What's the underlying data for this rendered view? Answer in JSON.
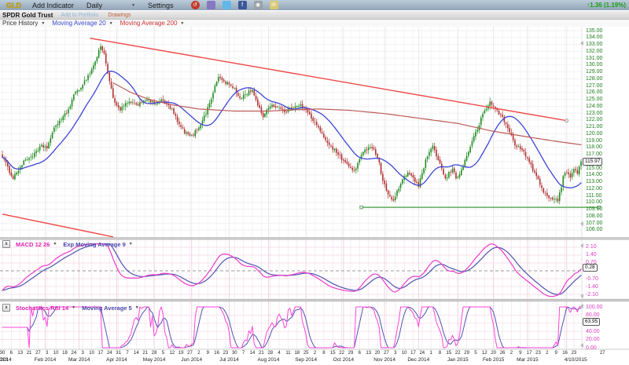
{
  "titlebar": {
    "symbol": "GLD",
    "add_indicator": "Add Indicator",
    "period": "Daily",
    "settings": "Settings",
    "change_arrow": "↑",
    "change": "1.36 (1.19%)",
    "icons": [
      {
        "name": "history-icon",
        "color": "#c23b2e",
        "glyph": "↺",
        "round": true
      },
      {
        "name": "cube-icon",
        "color": "#8578c0",
        "glyph": ""
      },
      {
        "name": "twitter-icon",
        "color": "#62b7e8",
        "glyph": ""
      },
      {
        "name": "facebook-icon",
        "color": "#3b5998",
        "glyph": "f"
      },
      {
        "name": "camera-icon",
        "color": "#9aa0a6",
        "glyph": "◉"
      },
      {
        "name": "mail-icon",
        "color": "#d9c873",
        "glyph": "✉"
      }
    ]
  },
  "subbar": {
    "title": "SPDR Gold Trust",
    "add_to_portfolio": "Add to Portfolio",
    "drawings": "Drawings"
  },
  "legend": {
    "price_history": "Price History",
    "ma20": "Moving Average 20",
    "ma200": "Moving Average 200"
  },
  "price_axis": {
    "badge": "115.97",
    "ticks": [
      "135.00",
      "134.00",
      "133.00",
      "132.00",
      "131.00",
      "130.00",
      "129.00",
      "128.00",
      "127.00",
      "126.00",
      "125.00",
      "124.00",
      "123.00",
      "122.00",
      "121.00",
      "120.00",
      "119.00",
      "118.00",
      "117.00",
      "115.00",
      "114.00",
      "113.00",
      "112.00",
      "111.00",
      "110.00",
      "109.00",
      "108.00",
      "107.00",
      "106.00"
    ]
  },
  "panels": {
    "macd": {
      "close": "x",
      "label": "MACD 12 26",
      "label2": "Exp Moving Average 9",
      "badge": "0.28",
      "ticks": [
        {
          "v": 2.1,
          "label": "2.10"
        },
        {
          "v": 1.4,
          "label": "1.40"
        },
        {
          "v": 0.7,
          "label": "0.70"
        },
        {
          "v": -0.7,
          "label": "-0.70"
        },
        {
          "v": -1.4,
          "label": "-1.40"
        },
        {
          "v": -2.1,
          "label": "-2.10"
        }
      ]
    },
    "stoch": {
      "close": "x",
      "label": "Stochastics RSI 14",
      "label2": "Moving Average 5",
      "badge": "63.95",
      "ticks": [
        {
          "v": 100,
          "label": "100.00"
        },
        {
          "v": 80,
          "label": "80.00"
        },
        {
          "v": 40,
          "label": "40.00"
        },
        {
          "v": 20,
          "label": "20.00"
        },
        {
          "v": 0,
          "label": "0.00"
        }
      ]
    }
  },
  "xaxis": {
    "day_ticks": [
      "30",
      "6",
      "13",
      "21",
      "27",
      "3",
      "10",
      "18",
      "24",
      "3",
      "10",
      "17",
      "24",
      "31",
      "7",
      "14",
      "21",
      "28",
      "5",
      "12",
      "19",
      "27",
      "2",
      "9",
      "16",
      "23",
      "30",
      "7",
      "14",
      "21",
      "28",
      "4",
      "11",
      "18",
      "25",
      "2",
      "8",
      "15",
      "22",
      "29",
      "6",
      "13",
      "20",
      "27",
      "3",
      "10",
      "17",
      "24",
      "1",
      "8",
      "15",
      "22",
      "29",
      "5",
      "12",
      "20",
      "26",
      "2",
      "9",
      "17",
      "23",
      "2",
      "9",
      "16",
      "23"
    ],
    "extra_tick": {
      "day": 336,
      "label": "27"
    },
    "months": [
      {
        "day": 0,
        "label": "2013"
      },
      {
        "day": 2,
        "label": "2014"
      },
      {
        "day": 24,
        "label": "Feb 2014"
      },
      {
        "day": 43,
        "label": "Mar 2014"
      },
      {
        "day": 64,
        "label": "Apr 2014"
      },
      {
        "day": 85,
        "label": "May 2014"
      },
      {
        "day": 106,
        "label": "Jun 2014"
      },
      {
        "day": 127,
        "label": "Jul 2014"
      },
      {
        "day": 149,
        "label": "Aug 2014"
      },
      {
        "day": 170,
        "label": "Sep 2014"
      },
      {
        "day": 191,
        "label": "Oct 2014"
      },
      {
        "day": 214,
        "label": "Nov 2014"
      },
      {
        "day": 233,
        "label": "Dec 2014"
      },
      {
        "day": 255,
        "label": "Jan 2015"
      },
      {
        "day": 275,
        "label": "Feb 2015"
      },
      {
        "day": 294,
        "label": "Mar 2015"
      },
      {
        "day": 321,
        "label": "4/10/2015"
      }
    ]
  },
  "chart_data": {
    "type": "candlestick",
    "symbol": "GLD",
    "title": "SPDR Gold Trust",
    "timeframe": "Daily",
    "date_range": [
      "12/30/2013",
      "4/10/2015"
    ],
    "num_days": 325,
    "price_range": [
      106,
      135
    ],
    "last_price": 115.97,
    "change": 1.36,
    "change_pct": "1.19%",
    "overlays": [
      "Moving Average 20",
      "Moving Average 200"
    ],
    "close_keypoints": [
      [
        0,
        116.8
      ],
      [
        3,
        115.0
      ],
      [
        6,
        113.6
      ],
      [
        9,
        114.8
      ],
      [
        13,
        116.2
      ],
      [
        18,
        117.0
      ],
      [
        22,
        118.2
      ],
      [
        25,
        118.0
      ],
      [
        30,
        121.3
      ],
      [
        36,
        123.0
      ],
      [
        40,
        125.5
      ],
      [
        45,
        127.2
      ],
      [
        49,
        128.8
      ],
      [
        52,
        130.5
      ],
      [
        55,
        132.8
      ],
      [
        57,
        131.5
      ],
      [
        59,
        129.0
      ],
      [
        61,
        126.5
      ],
      [
        63,
        124.3
      ],
      [
        66,
        123.4
      ],
      [
        70,
        124.6
      ],
      [
        75,
        124.2
      ],
      [
        80,
        125.0
      ],
      [
        85,
        124.4
      ],
      [
        90,
        124.8
      ],
      [
        95,
        123.5
      ],
      [
        99,
        121.2
      ],
      [
        103,
        120.0
      ],
      [
        106,
        119.6
      ],
      [
        110,
        121.0
      ],
      [
        114,
        123.0
      ],
      [
        118,
        126.0
      ],
      [
        121,
        128.3
      ],
      [
        124,
        127.6
      ],
      [
        127,
        127.2
      ],
      [
        130,
        126.4
      ],
      [
        133,
        125.2
      ],
      [
        137,
        125.9
      ],
      [
        140,
        126.5
      ],
      [
        143,
        124.0
      ],
      [
        146,
        122.6
      ],
      [
        150,
        124.2
      ],
      [
        154,
        123.9
      ],
      [
        158,
        123.2
      ],
      [
        162,
        123.8
      ],
      [
        166,
        124.3
      ],
      [
        170,
        123.4
      ],
      [
        174,
        122.0
      ],
      [
        178,
        120.3
      ],
      [
        182,
        118.8
      ],
      [
        186,
        117.6
      ],
      [
        190,
        116.4
      ],
      [
        194,
        115.2
      ],
      [
        197,
        114.6
      ],
      [
        200,
        116.2
      ],
      [
        203,
        117.6
      ],
      [
        206,
        118.3
      ],
      [
        209,
        117.2
      ],
      [
        211,
        115.8
      ],
      [
        213,
        113.0
      ],
      [
        216,
        111.4
      ],
      [
        219,
        110.1
      ],
      [
        221,
        111.6
      ],
      [
        224,
        113.2
      ],
      [
        227,
        114.4
      ],
      [
        230,
        113.6
      ],
      [
        233,
        112.3
      ],
      [
        236,
        115.2
      ],
      [
        238,
        116.8
      ],
      [
        241,
        118.0
      ],
      [
        243,
        116.9
      ],
      [
        245,
        115.6
      ],
      [
        248,
        113.3
      ],
      [
        250,
        114.2
      ],
      [
        252,
        114.9
      ],
      [
        254,
        113.6
      ],
      [
        257,
        114.6
      ],
      [
        260,
        116.8
      ],
      [
        263,
        118.9
      ],
      [
        266,
        120.7
      ],
      [
        269,
        122.8
      ],
      [
        273,
        124.6
      ],
      [
        275,
        123.9
      ],
      [
        277,
        123.4
      ],
      [
        280,
        122.3
      ],
      [
        283,
        120.8
      ],
      [
        287,
        118.5
      ],
      [
        290,
        117.8
      ],
      [
        293,
        116.9
      ],
      [
        296,
        115.3
      ],
      [
        299,
        113.8
      ],
      [
        302,
        112.0
      ],
      [
        305,
        111.0
      ],
      [
        308,
        110.5
      ],
      [
        311,
        110.2
      ],
      [
        313,
        112.4
      ],
      [
        314,
        114.1
      ],
      [
        316,
        114.6
      ],
      [
        318,
        113.6
      ],
      [
        320,
        114.9
      ],
      [
        322,
        114.3
      ],
      [
        324,
        115.97
      ]
    ],
    "ma200_keypoints": [
      [
        62,
        127.4
      ],
      [
        72,
        126.0
      ],
      [
        82,
        125.0
      ],
      [
        95,
        124.2
      ],
      [
        110,
        123.6
      ],
      [
        130,
        123.3
      ],
      [
        150,
        123.3
      ],
      [
        165,
        123.5
      ],
      [
        177,
        123.6
      ],
      [
        195,
        123.4
      ],
      [
        215,
        122.9
      ],
      [
        235,
        122.2
      ],
      [
        255,
        121.5
      ],
      [
        274,
        120.4
      ],
      [
        295,
        119.5
      ],
      [
        310,
        118.9
      ],
      [
        324,
        118.4
      ]
    ],
    "indicators": [
      {
        "name": "MACD 12 26",
        "signal": "Exp Moving Average 9",
        "range": [
          -2.45,
          2.45
        ],
        "gridstep": 0.7,
        "last": 0.28
      },
      {
        "name": "Stochastics RSI 14",
        "ma": "Moving Average 5",
        "range": [
          0,
          100
        ],
        "gridstep": 20,
        "last": 63.95
      }
    ],
    "drawings": {
      "trendline_upper": {
        "from_day": 49,
        "from_price": 133.9,
        "to_day": 316,
        "to_price": 121.9,
        "end_marker": true
      },
      "trendline_lower": {
        "from_day": 0,
        "from_price": 108.3,
        "to_day": 62,
        "to_price": 105.0
      },
      "support_line": {
        "from_day": 201,
        "to_day": 334,
        "price": 109.3,
        "markers": true
      }
    },
    "month_start_days": [
      24,
      43,
      64,
      85,
      106,
      127,
      149,
      170,
      191,
      214,
      233,
      255,
      275,
      294,
      316
    ]
  },
  "colors": {
    "candle_up": "#1f8b1f",
    "candle_down": "#b03030",
    "ma20": "#3c46d8",
    "ma200": "#bd5a58",
    "trendline": "#f04848",
    "support": "#3f9c3f",
    "macd_line": "#ef3bc9",
    "macd_signal": "#4d55b0",
    "stoch_line": "#ff46d8",
    "stoch_ma": "#4d55b0",
    "price_tick": "#1d7d1d",
    "ind_tick": "#e23bc0"
  }
}
